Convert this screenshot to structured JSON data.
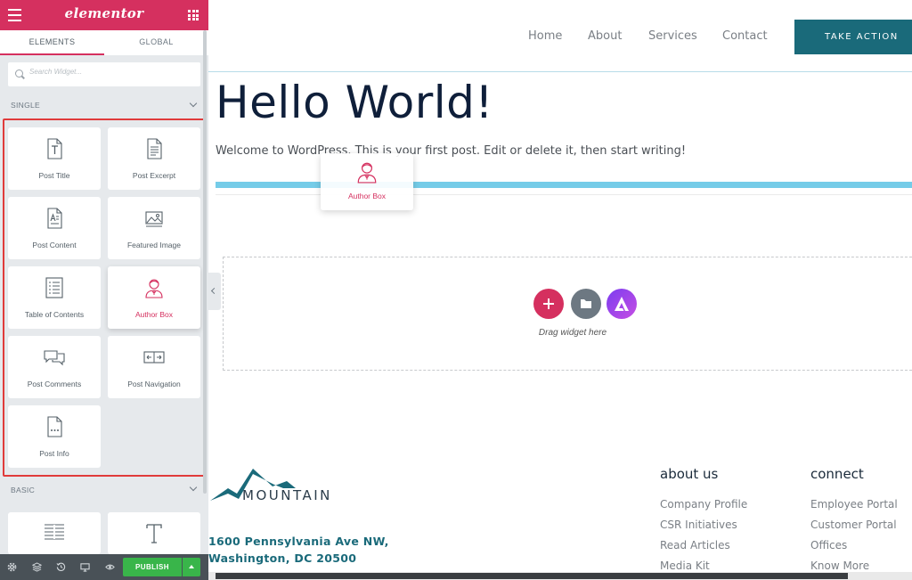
{
  "sidebar": {
    "logo": "elementor",
    "tabs": [
      {
        "label": "ELEMENTS"
      },
      {
        "label": "GLOBAL"
      }
    ],
    "search": {
      "placeholder": "Search Widget..."
    },
    "sections": {
      "single": "SINGLE",
      "basic": "BASIC"
    },
    "widgets": [
      {
        "label": "Post Title",
        "icon": "post-title-icon"
      },
      {
        "label": "Post Excerpt",
        "icon": "post-excerpt-icon"
      },
      {
        "label": "Post Content",
        "icon": "post-content-icon"
      },
      {
        "label": "Featured Image",
        "icon": "featured-image-icon"
      },
      {
        "label": "Table of Contents",
        "icon": "table-of-contents-icon"
      },
      {
        "label": "Author Box",
        "icon": "author-box-icon"
      },
      {
        "label": "Post Comments",
        "icon": "post-comments-icon"
      },
      {
        "label": "Post Navigation",
        "icon": "post-navigation-icon"
      },
      {
        "label": "Post Info",
        "icon": "post-info-icon"
      }
    ],
    "footer": {
      "publish_label": "PUBLISH"
    },
    "colors": {
      "brand": "#d5305f",
      "publish": "#39b54a",
      "highlight": "#e03b3b"
    }
  },
  "preview": {
    "nav": [
      "Home",
      "About",
      "Services",
      "Contact"
    ],
    "cta": "TAKE ACTION",
    "hero_title": "Hello World!",
    "hero_text": "Welcome to WordPress. This is your first post. Edit or delete it, then start writing!",
    "dragging_widget": "Author Box",
    "drop_text": "Drag widget here",
    "footer": {
      "logo_text": "MOUNTAIN",
      "address_line1": "1600 Pennsylvania Ave NW,",
      "address_line2": "Washington, DC 20500",
      "about": {
        "title": "about us",
        "links": [
          "Company Profile",
          "CSR Initiatives",
          "Read Articles",
          "Media Kit"
        ]
      },
      "connect": {
        "title": "connect",
        "links": [
          "Employee Portal",
          "Customer Portal",
          "Offices",
          "Know More"
        ]
      }
    },
    "colors": {
      "accent": "#1a6a7a",
      "heading": "#0f1f3a",
      "bar": "#75cce8"
    }
  }
}
